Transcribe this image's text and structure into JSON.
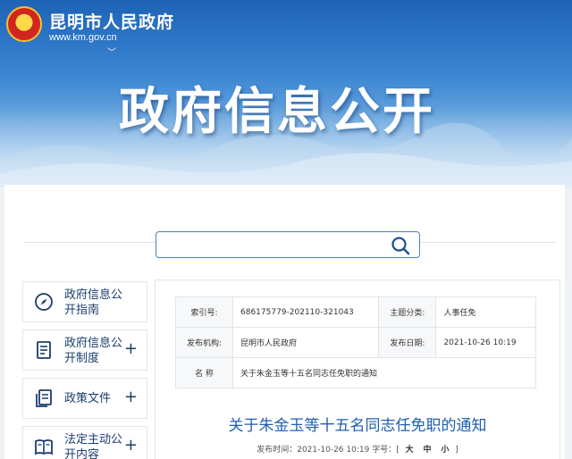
{
  "header": {
    "site_name": "昆明市人民政府",
    "site_url": "www.km.gov.cn",
    "banner_title": "政府信息公开"
  },
  "search": {
    "placeholder": ""
  },
  "sidebar": {
    "items": [
      {
        "label": "政府信息公开指南",
        "icon": "compass-icon",
        "expandable": false
      },
      {
        "label": "政府信息公开制度",
        "icon": "document-icon",
        "expandable": true
      },
      {
        "label": "政策文件",
        "icon": "files-icon",
        "expandable": true
      },
      {
        "label": "法定主动公开内容",
        "icon": "book-icon",
        "expandable": true
      }
    ],
    "expand_symbol": "+"
  },
  "meta": {
    "index_label": "索引号:",
    "index_value": "686175779-202110-321043",
    "topic_label": "主题分类:",
    "topic_value": "人事任免",
    "org_label": "发布机构:",
    "org_value": "昆明市人民政府",
    "date_label": "发布日期:",
    "date_value": "2021-10-26 10:19",
    "name_label": "名 称",
    "name_value": "关于朱金玉等十五名同志任免职的通知"
  },
  "doc": {
    "title": "关于朱金玉等十五名同志任免职的通知",
    "publish_prefix": "发布时间：",
    "publish_time": "2021-10-26 10:19",
    "font_size_label": "字号：[",
    "size_large": "大",
    "size_medium": "中",
    "size_small": "小",
    "bracket_close": "]"
  },
  "colors": {
    "accent": "#1f5fb0",
    "sidebar_text": "#1a3c6e",
    "banner_top": "#1e63b6"
  }
}
